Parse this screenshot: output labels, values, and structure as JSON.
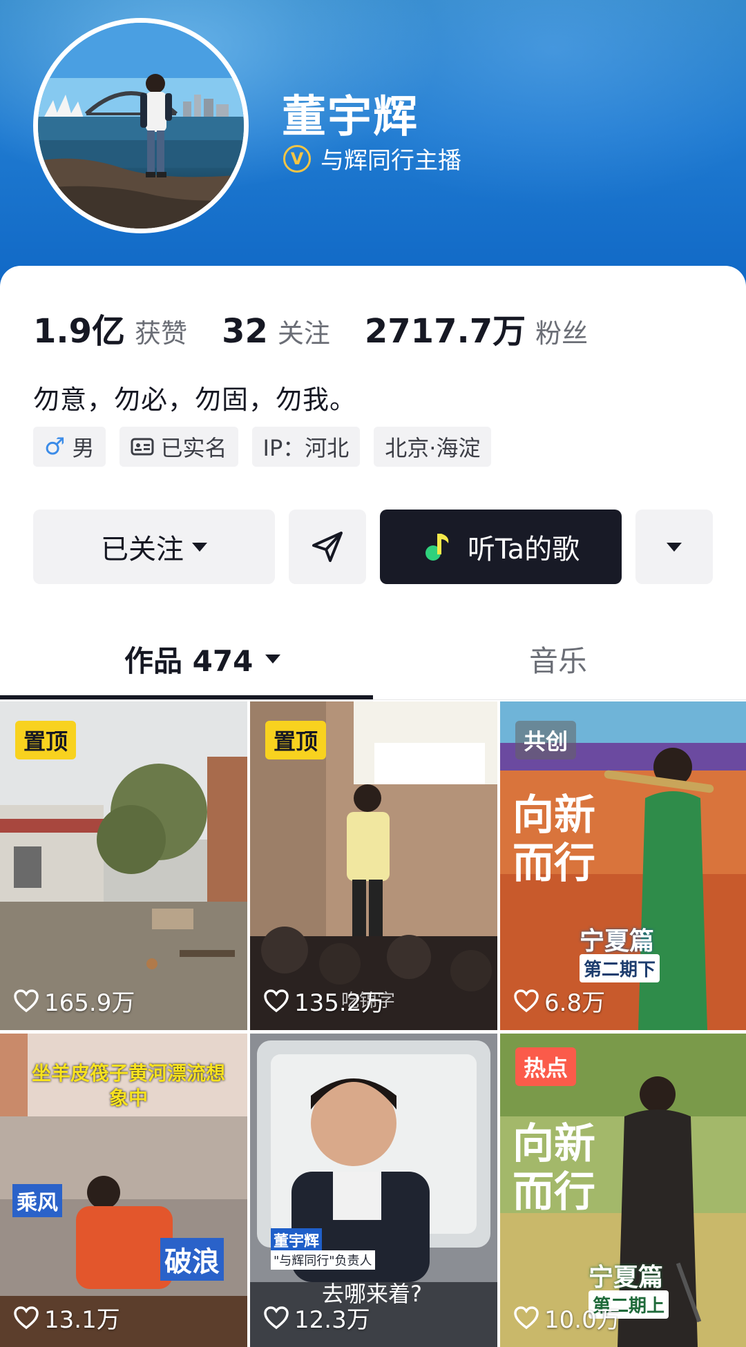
{
  "profile": {
    "name": "董宇辉",
    "verification": "与辉同行主播"
  },
  "stats": [
    {
      "value": "1.9亿",
      "label": "获赞"
    },
    {
      "value": "32",
      "label": "关注"
    },
    {
      "value": "2717.7万",
      "label": "粉丝"
    }
  ],
  "bio": "勿意，勿必，勿固，勿我。",
  "tags": [
    {
      "icon": "male-icon",
      "label": "男"
    },
    {
      "icon": "id-card-icon",
      "label": "已实名"
    },
    {
      "icon": "",
      "label": "IP：河北"
    },
    {
      "icon": "",
      "label": "北京·海淀"
    }
  ],
  "actions": {
    "follow_label": "已关注",
    "listen_label": "听Ta的歌"
  },
  "tabs": {
    "works_label": "作品 474",
    "music_label": "音乐"
  },
  "videos": [
    {
      "badge": "置顶",
      "likes": "165.9万"
    },
    {
      "badge": "置顶",
      "likes": "135.2万",
      "overlay": "吃锦字"
    },
    {
      "badge": "共创",
      "likes": "6.8万",
      "title": "向新而行",
      "subtitle": "宁夏篇",
      "episode": "第二期下"
    },
    {
      "badge": "",
      "likes": "13.1万",
      "caption": "坐羊皮筏子黄河漂流想象中",
      "tag_left": "乘风",
      "tag_right": "破浪"
    },
    {
      "badge": "",
      "likes": "12.3万",
      "name_tag": "董宇辉",
      "role_tag": "\"与辉同行\"负责人",
      "caption": "去哪来着?"
    },
    {
      "badge": "热点",
      "likes": "10.0万",
      "title": "向新而行",
      "subtitle": "宁夏篇",
      "episode": "第二期上"
    }
  ],
  "colors": {
    "header_blue": "#1f7ad0",
    "badge_pin": "#f8d21f",
    "badge_hot": "#fb5b4a",
    "dark_button": "#181a26",
    "music_icon_green": "#2fd17c"
  }
}
